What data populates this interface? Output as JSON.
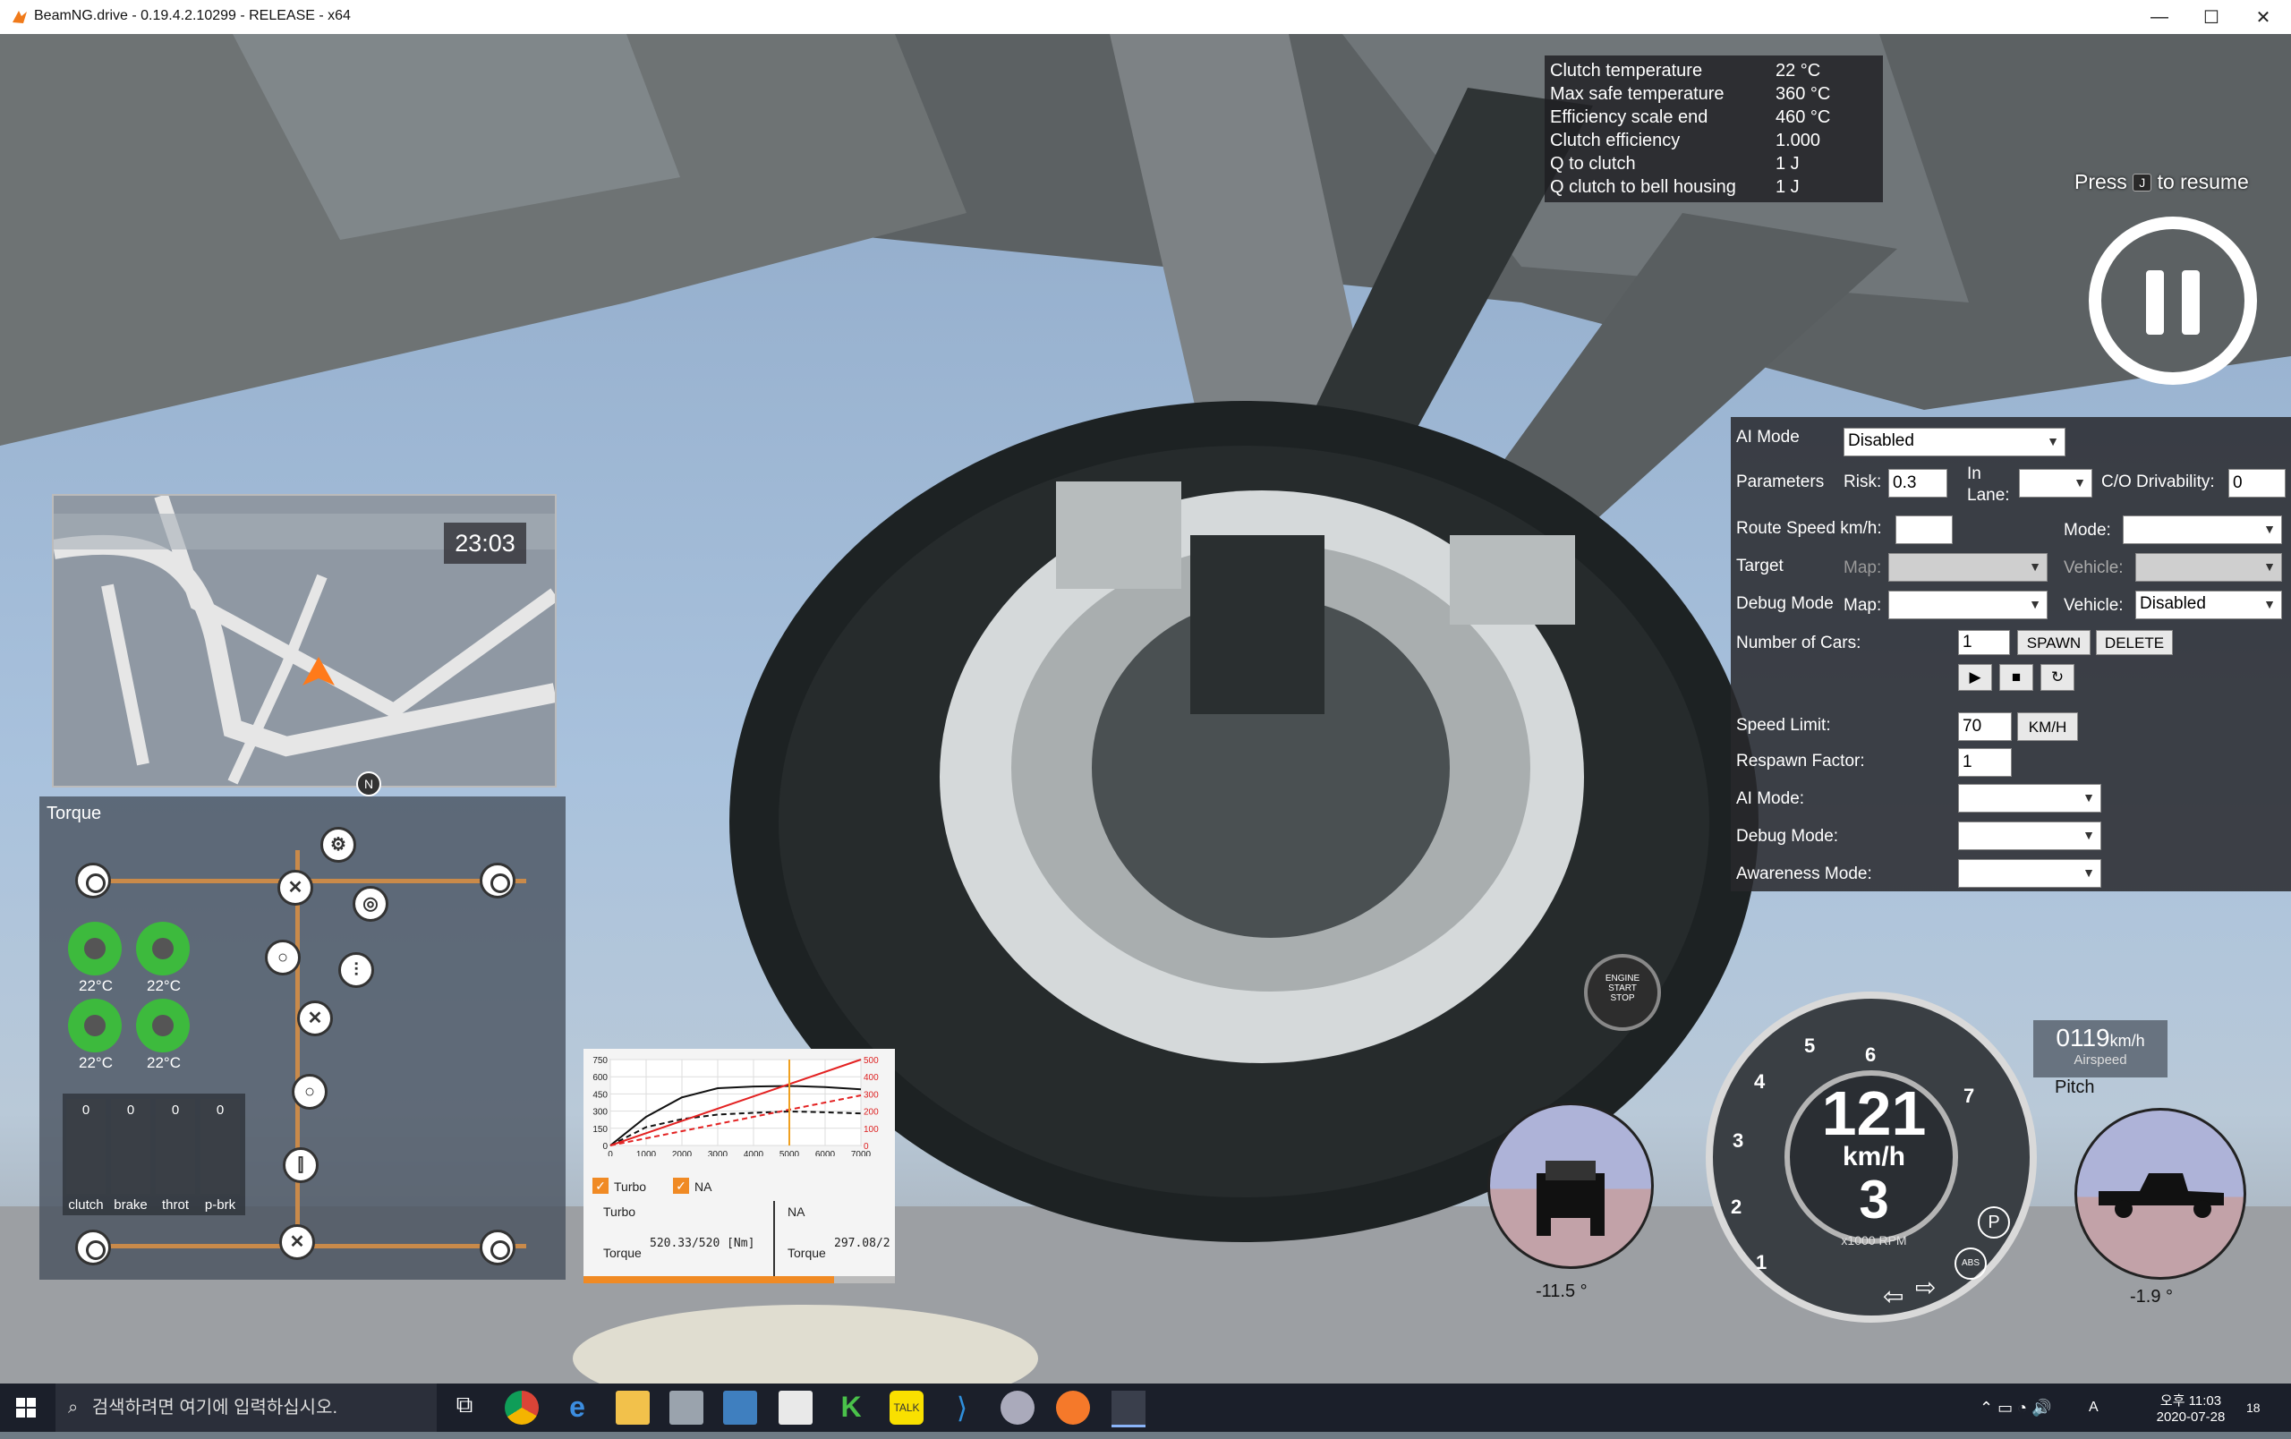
{
  "window": {
    "title": "BeamNG.drive - 0.19.4.2.10299 - RELEASE - x64",
    "minimize": "—",
    "maximize": "☐",
    "close": "✕"
  },
  "clutch": {
    "rows": [
      {
        "label": "Clutch temperature",
        "value": "22 °C"
      },
      {
        "label": "Max safe temperature",
        "value": "360 °C"
      },
      {
        "label": "Efficiency scale end",
        "value": "460 °C"
      },
      {
        "label": "Clutch efficiency",
        "value": "1.000"
      },
      {
        "label": "Q to clutch",
        "value": "1 J"
      },
      {
        "label": "Q clutch to bell housing",
        "value": "1 J"
      }
    ]
  },
  "pause": {
    "press": "Press",
    "key": "J",
    "resume": "to resume"
  },
  "ai": {
    "ai_mode_label": "AI Mode",
    "ai_mode_value": "Disabled",
    "parameters_label": "Parameters",
    "risk_label": "Risk:",
    "risk_value": "0.3",
    "in_lane_label": "In Lane:",
    "co_label": "C/O Drivability:",
    "co_value": "0",
    "route_speed_label": "Route Speed km/h:",
    "mode_label": "Mode:",
    "target_label": "Target",
    "map_label": "Map:",
    "vehicle_label": "Vehicle:",
    "debug_label": "Debug Mode",
    "debug_vehicle_value": "Disabled",
    "cars_label": "Number of Cars:",
    "cars_value": "1",
    "spawn": "SPAWN",
    "delete": "DELETE",
    "speed_limit_label": "Speed Limit:",
    "speed_limit_value": "70",
    "kmh": "KM/H",
    "respawn_label": "Respawn Factor:",
    "respawn_value": "1",
    "ai_mode2_label": "AI Mode:",
    "debug2_label": "Debug Mode:",
    "awareness_label": "Awareness Mode:"
  },
  "minimap": {
    "time": "23:03",
    "north": "N"
  },
  "torque": {
    "title": "Torque",
    "brakes": [
      "22°C",
      "22°C",
      "22°C",
      "22°C"
    ],
    "pedals": [
      {
        "label": "clutch",
        "value": "0"
      },
      {
        "label": "brake",
        "value": "0"
      },
      {
        "label": "throt",
        "value": "0"
      },
      {
        "label": "p-brk",
        "value": "0"
      }
    ]
  },
  "dyno": {
    "turbo": "Turbo",
    "na": "NA",
    "turbo_title": "Turbo",
    "na_title": "NA",
    "torque_label": "Torque",
    "turbo_torque": "520.33/520 [Nm]",
    "na_torque": "297.08/2",
    "y_left": [
      "750",
      "600",
      "450",
      "300",
      "150",
      "0"
    ],
    "y_right": [
      "500",
      "400",
      "300",
      "200",
      "100",
      "0"
    ],
    "x": [
      "0",
      "1000",
      "2000",
      "3000",
      "4000",
      "5000",
      "6000",
      "7000"
    ]
  },
  "chart_data": {
    "type": "line",
    "x": [
      0,
      1000,
      2000,
      3000,
      4000,
      5000,
      6000,
      7000
    ],
    "series": [
      {
        "name": "Turbo",
        "values": [
          0,
          250,
          420,
          500,
          515,
          520,
          510,
          490
        ]
      },
      {
        "name": "NA",
        "values": [
          0,
          160,
          230,
          270,
          285,
          297,
          290,
          280
        ]
      }
    ],
    "xlim": [
      0,
      7000
    ],
    "ylim": [
      0,
      750
    ],
    "legend": "bottom"
  },
  "gauges": {
    "speed": "121",
    "speed_unit": "km/h",
    "gear": "3",
    "rpm_unit": "x1000 RPM",
    "rpm_numbers": [
      "1",
      "2",
      "3",
      "4",
      "5",
      "6",
      "7"
    ],
    "roll": "-11.5 °",
    "pitch_label": "Pitch",
    "pitch": "-1.9 °",
    "airspeed_value": "0119",
    "airspeed_unit": "km/h",
    "airspeed_label": "Airspeed",
    "abs": "ABS",
    "park": "P",
    "engine": [
      "ENGINE",
      "START",
      "STOP"
    ]
  },
  "taskbar": {
    "search_placeholder": "검색하려면 여기에 입력하십시오.",
    "time": "오후 11:03",
    "date": "2020-07-28",
    "lang": "A",
    "notif": "18"
  }
}
